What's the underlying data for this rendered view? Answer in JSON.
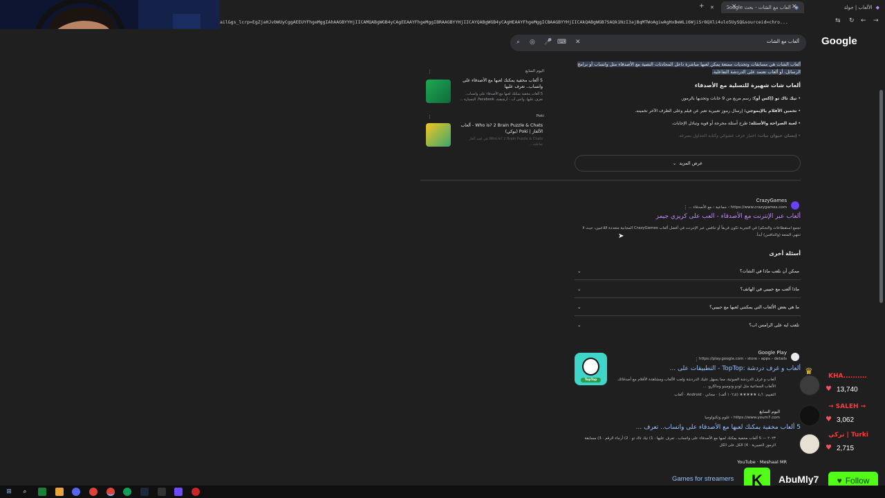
{
  "browser": {
    "tabs": [
      {
        "title": "الألعاب | جولة",
        "active": false
      },
      {
        "title": "ألعاب مع الشات - بحث Google",
        "active": true
      }
    ],
    "new_tab_symbol": "+",
    "close_symbol": "✕",
    "url": "ail&gs_lcrp=EgZjaHJvbWUyCggAEEUYFhgeMggIAhAAGBYYHjIICAMQABgWGB4yCAgEEAAYFhgeMggIBRAAGBYYHjIICAYQABgWGB4yCAgHEAAYFhgeMggICBAAGBYYHjIICAkQABgWGB7SAQk1NzI3ajBqMTWoAgiwAgHxBeWLi6WjiSr8QXli4ulo5UySQ&sourceid=chro..."
  },
  "search": {
    "logo": "Google",
    "query": "ألعاب مع الشات"
  },
  "ai_overview": {
    "intro_highlight": "ألعاب الشات هي مسابقات وتحديات ممتعة يمكن لعبها مباشرة داخل المحادثات النصية مع الأصدقاء مثل واتساب أو برامج الرسائل، أو ألعاب تعتمد على الدردشة التفاعلية.",
    "heading": "ألعاب شات شهيرة للتسلية مع الأصدقاء",
    "bullets": [
      {
        "bold": "تيك تاك تو (إكس أو):",
        "text": "رسم مربع من 9 خانات وتحديها بالرموز."
      },
      {
        "bold": "تخمين الأفلام بالإيموجي:",
        "text": "إرسال رموز تعبيرية تعبر عن فيلم وعلى الطرف الآخر تخمينه."
      },
      {
        "bold": "لعبة الصراحة والأسئلة:",
        "text": "طرح أسئلة محرجة أو قوية وتبادل الإجابات."
      },
      {
        "bold": "إنسان حيوان نبات:",
        "text": "اختيار حرف عشوائي وكتابة الجداول بسرعة."
      }
    ],
    "show_more": "عرض المزيد"
  },
  "side_cards": [
    {
      "source": "اليوم السابع",
      "title": "5 ألعاب مخفية يمكنك لعبها مع الأصدقاء على واتساب.. تعرف عليها",
      "desc": "5 ألعاب مخفية يمكنك لعبها مع الأصدقاء على واتساب.. تعرف عليها. واتس آب - أرشيفية. Facebook. البسيارة ..."
    },
    {
      "source": "Poki",
      "title": "Who is? 2 Brain Puzzle & Chats - ألعاب الألغاز | Poki (بوكي)",
      "desc": "Who is? 2 Brain Puzzle & Chats هي لعبة ألغاز تفاعلية..."
    }
  ],
  "results": [
    {
      "site": "CrazyGames",
      "cite": "https://www.crazygames.com › جماعية › مع الأصدقاء ...",
      "title": "ألعاب عبر الإنترنت مع الأصدقاء - العب على كريزي جيمز",
      "desc": "تجمع استقطاعات والتحكم) في التجربة تكون فريقاً أو تنافس عبر الإنترنت في أفضل ألعاب CrazyGames المجانية متعددة اللاعبين، حيث لا تنتهي المتعة (والتنافس) أبداً."
    },
    {
      "site": "Google Play",
      "cite": "https://play.google.com › store › apps › details",
      "title": "ألعاب و غرف دردشة :TopTop - التطبيقات على ...",
      "desc": "ألعاب و غرف الدردشة الصوتية، مما يسهل عليك الدردشة ولعب الألعاب ومشاهدة الأفلام مع أصدقائك. الألعاب الجماعية مثل لودو ودومينو وجاكارو، ...",
      "meta": "التقييم: ٤٫٦ ★★★★★ (١٠٢٫٥ ألف) · مجاني · Android · ألعاب",
      "app_name": "TopTop"
    },
    {
      "site": "اليوم السابع",
      "cite": "https://www.youm7.com › علوم وتكنولوجيا",
      "title": "5 ألعاب مخفية يمكنك لعبها مع الأصدقاء على واتساب.. تعرف ...",
      "desc": "٢٠٢٣ — 5 ألعاب مخفية يمكنك لعبها مع الأصدقاء على واتساب.. تعرف عليها · 1) تيك تاك تو · 2) أرجاء الرقم · 3) مسابقة الرموز التعبيرية · 4) الكل على الكل"
    },
    {
      "site": "YouTube · Meshaal MR",
      "cite": "",
      "title": "Games for streamers"
    }
  ],
  "people_also_ask": {
    "heading": "أسئلة أخرى",
    "items": [
      "ممكن أن نلعب ماذا في الشات؟",
      "ماذا ألعب مع حبيبي في الهاتف؟",
      "ما هي بعض الألعاب التي يمكنني لعبها مع حبيبي؟",
      "تلعب ايه على الرامس اب؟"
    ]
  },
  "overlay": {
    "chat": [
      {
        "name": "KHA..........",
        "count": "13,740"
      },
      {
        "name": "→ SALEH →",
        "count": "3,062"
      },
      {
        "name": "تركي | Turki",
        "count": "2,715"
      }
    ],
    "streamer_name": "AbuMly7",
    "follow_label": "Follow",
    "kick_letter": "K"
  },
  "colors": {
    "link": "#99c3ff",
    "visited": "#c58af9",
    "kick_green": "#53fc18",
    "highlight": "#394457"
  }
}
